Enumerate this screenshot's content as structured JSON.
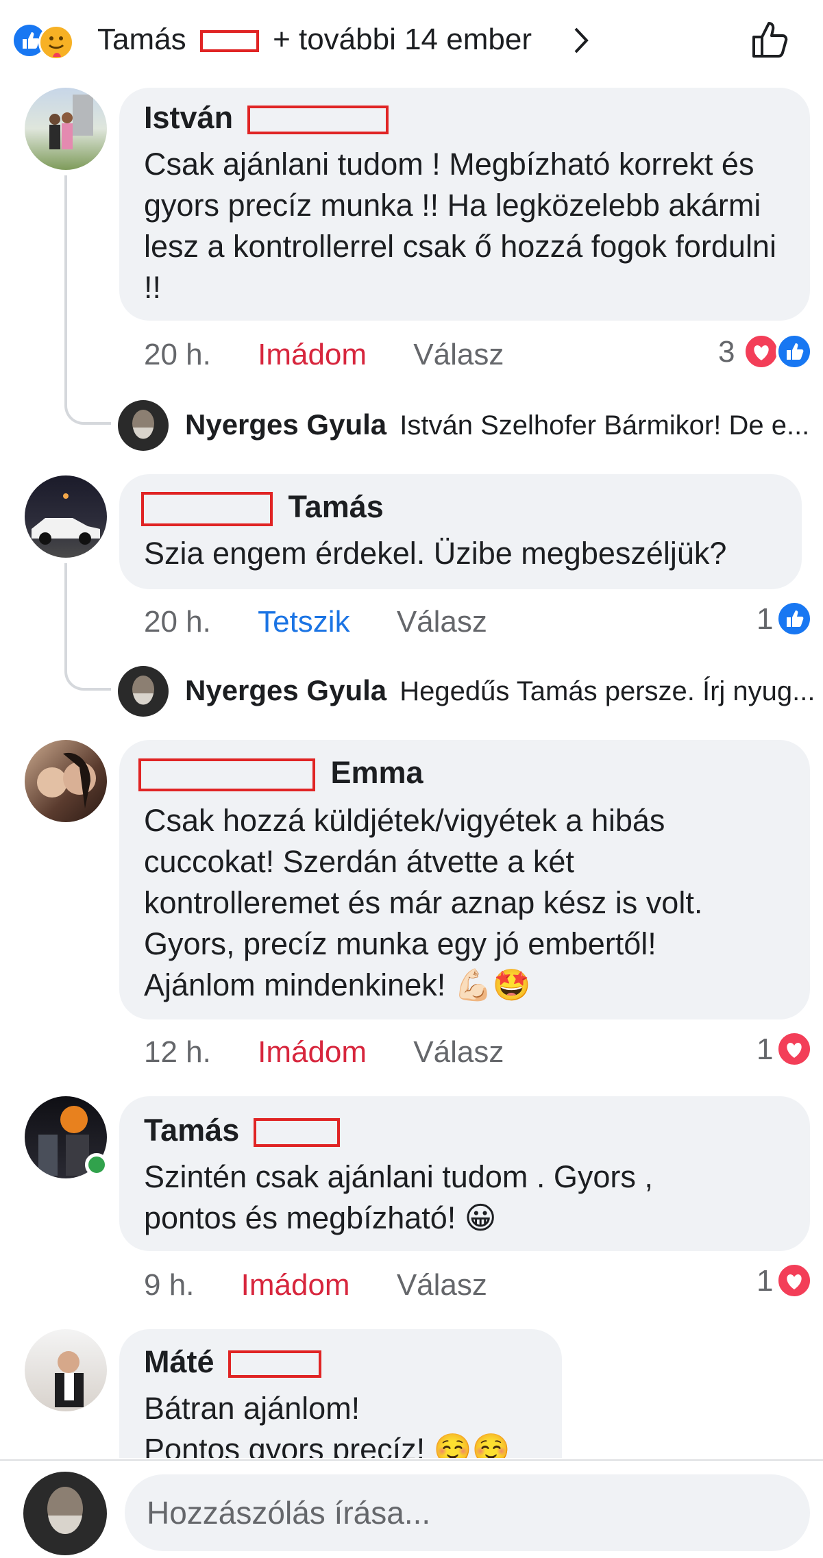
{
  "header": {
    "name": "Tamás",
    "more_text": "+ további 14 ember",
    "icons": [
      "like-reaction-icon",
      "care-reaction-icon",
      "chevron-right-icon",
      "thumbs-up-outline-icon"
    ]
  },
  "comments": [
    {
      "author": "István",
      "text": "Csak ajánlani tudom ! Megbízható korrekt és gyors precíz munka !! Ha legközelebb akármi lesz a kontrollerrel csak ő hozzá fogok fordulni !!",
      "time": "20 h.",
      "reaction_label": "Imádom",
      "reply_label": "Válasz",
      "reaction_count": "3",
      "reply": {
        "name": "Nyerges Gyula",
        "preview": "István Szelhofer Bármikor! De e..."
      }
    },
    {
      "author": "Tamás",
      "text": "Szia engem érdekel. Üzibe megbeszéljük?",
      "time": "20 h.",
      "reaction_label": "Tetszik",
      "reply_label": "Válasz",
      "reaction_count": "1",
      "reply": {
        "name": "Nyerges Gyula",
        "preview": "Hegedűs Tamás persze. Írj nyug..."
      }
    },
    {
      "author": "Emma",
      "text_lines": [
        "Csak hozzá küldjétek/vigyétek a hibás",
        "cuccokat! Szerdán átvette a két",
        "kontrolleremet és már aznap kész is volt.",
        "Gyors, precíz munka egy jó embertől!",
        "Ajánlom mindenkinek! 💪🏻🤩"
      ],
      "time": "12 h.",
      "reaction_label": "Imádom",
      "reply_label": "Válasz",
      "reaction_count": "1"
    },
    {
      "author": "Tamás",
      "text_lines": [
        "Szintén csak ajánlani tudom . Gyors ,",
        "pontos  és megbízható! 😀"
      ],
      "time": "9 h.",
      "reaction_label": "Imádom",
      "reply_label": "Válasz",
      "reaction_count": "1"
    },
    {
      "author": "Máté",
      "text_lines": [
        "Bátran ajánlom!",
        "Pontos gyors precíz! ☺️☺️"
      ]
    }
  ],
  "composer": {
    "placeholder": "Hozzászólás írása..."
  },
  "colors": {
    "accent_blue": "#1877f2",
    "love_red": "#d7263d",
    "bubble": "#f0f2f5"
  }
}
